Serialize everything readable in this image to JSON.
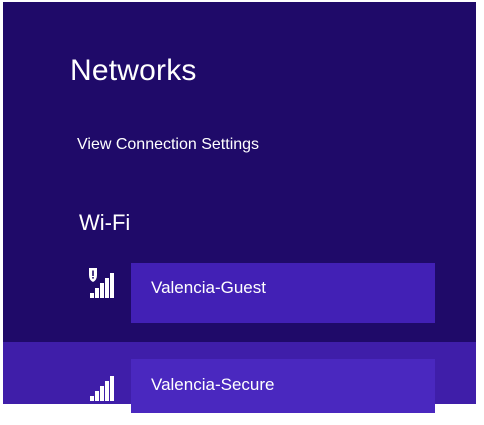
{
  "networks": {
    "title": "Networks",
    "view_settings_label": "View Connection Settings",
    "wifi_section_label": "Wi-Fi",
    "items": [
      {
        "name": "Valencia-Guest",
        "secured": false,
        "warning_shield": true,
        "icon": "wifi-signal-icon"
      },
      {
        "name": "Valencia-Secure",
        "secured": true,
        "warning_shield": false,
        "icon": "wifi-signal-icon"
      }
    ]
  },
  "colors": {
    "background": "#1f0a69",
    "selected_row": "#3f1ea9",
    "network_box": "#4220b5",
    "text": "#ffffff"
  }
}
